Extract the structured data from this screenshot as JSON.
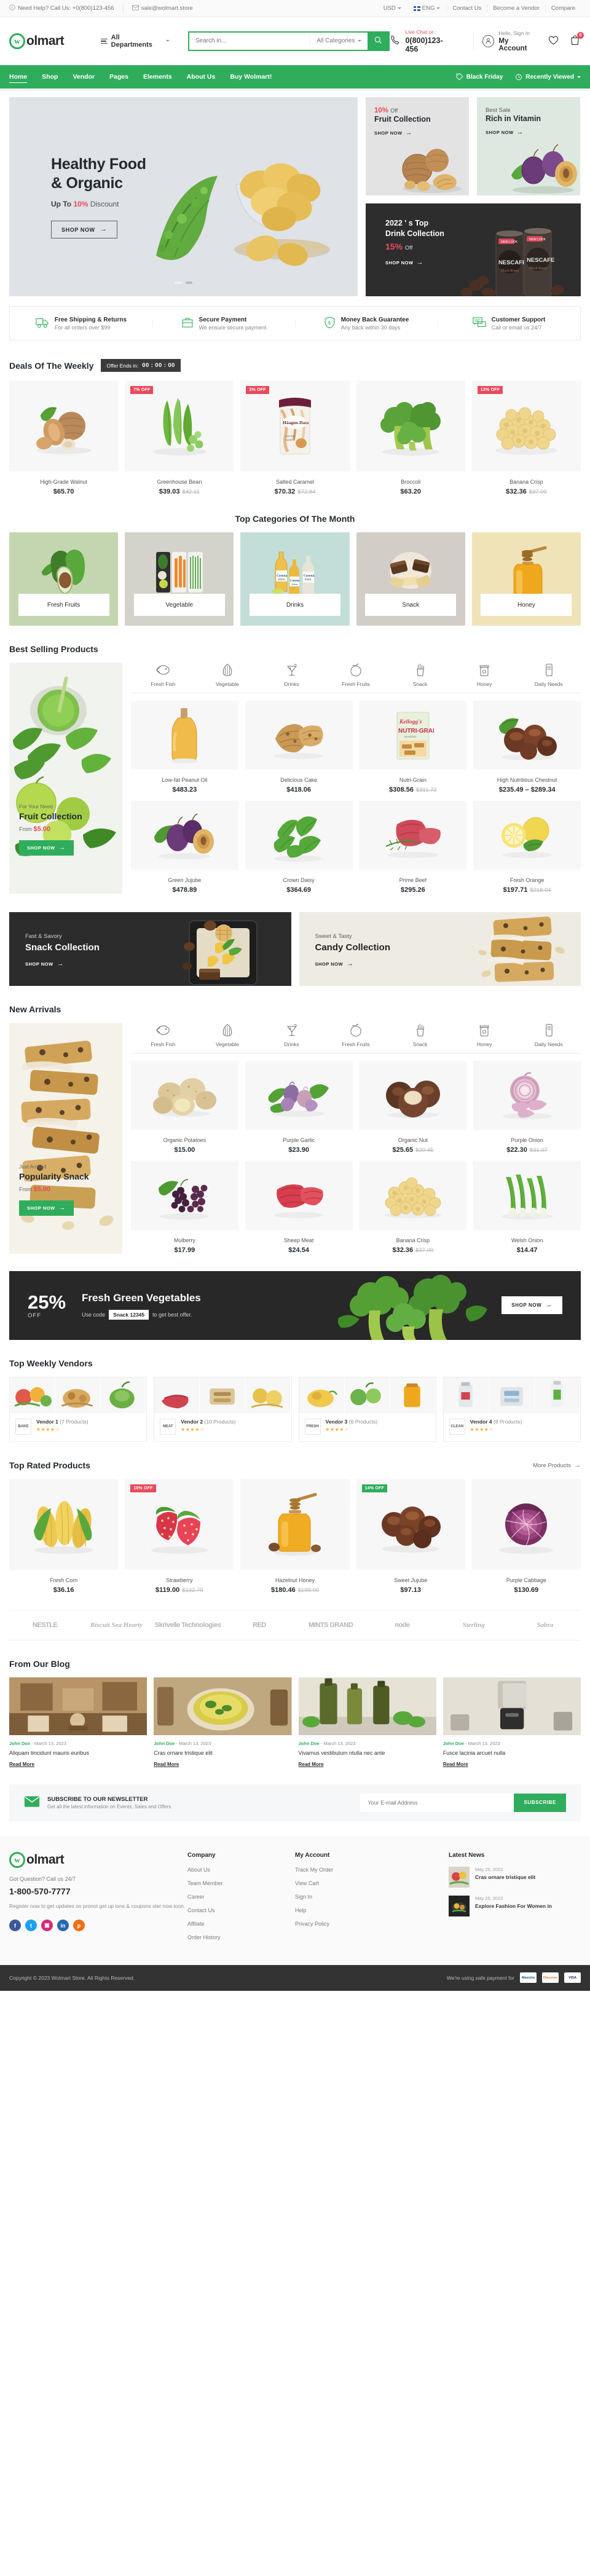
{
  "topbar": {
    "help_text": "Need Help? Call Us: +0(800)123-456",
    "email": "sale@wolmart.store",
    "currency": "USD",
    "language": "ENG",
    "links": [
      "Contact Us",
      "Become a Vendor",
      "Compare"
    ]
  },
  "header": {
    "logo_mark": "w",
    "logo_text": "olmart",
    "departments_label": "All Departments",
    "search_placeholder": "Search in...",
    "search_value": "",
    "category_select": "All Categories",
    "livechat_label": "Live Chat or :",
    "phone": "0(800)123-456",
    "account_greeting": "Hello, Sign In",
    "account_label": "My Account",
    "cart_count": "0",
    "icons": [
      "search-icon",
      "phone-icon",
      "user-icon",
      "heart-icon",
      "cart-icon"
    ]
  },
  "nav": {
    "items": [
      "Home",
      "Shop",
      "Vendor",
      "Pages",
      "Elements",
      "About Us",
      "Buy Wolmart!"
    ],
    "active": "Home",
    "right": [
      "Black Friday",
      "Recently Viewed"
    ]
  },
  "hero": {
    "title_line1": "Healthy Food",
    "title_line2": "& Organic",
    "sub_prefix": "Up To",
    "sub_pct": "10%",
    "sub_suffix": "Discount",
    "cta": "SHOP NOW",
    "dots": 2,
    "active_dot": 0
  },
  "hero_side": {
    "cards": [
      {
        "pct": "10%",
        "off": "Off",
        "title": "Fruit Collection",
        "cta": "SHOP NOW"
      },
      {
        "kicker": "Best Sale",
        "title": "Rich in Vitamin",
        "cta": "SHOP NOW"
      }
    ],
    "wide": {
      "line1": "2022 ' s Top",
      "line2": "Drink Collection",
      "pct": "15%",
      "off": "Off",
      "cta": "SHOP NOW"
    }
  },
  "services": [
    {
      "icon": "truck-icon",
      "title": "Free Shipping & Returns",
      "sub": "For all orders over $99"
    },
    {
      "icon": "briefcase-icon",
      "title": "Secure Payment",
      "sub": "We ensure secure payment"
    },
    {
      "icon": "money-back-icon",
      "title": "Money Back Guarantee",
      "sub": "Any back within 30 days"
    },
    {
      "icon": "chat-support-icon",
      "title": "Customer Support",
      "sub": "Call or email us 24/7"
    }
  ],
  "deals": {
    "title": "Deals Of The Weekly",
    "timer_label": "Offer Ends in:",
    "timer_value": "00 : 00 : 00",
    "products": [
      {
        "name": "High-Grade Walnut",
        "price": "$65.70",
        "old": "",
        "badge": ""
      },
      {
        "name": "Greenhouse Bean",
        "price": "$39.03",
        "old": "$42.11",
        "badge": "7% OFF"
      },
      {
        "name": "Salted Caramel",
        "price": "$70.32",
        "old": "$72.84",
        "badge": "3% OFF"
      },
      {
        "name": "Broccoli",
        "price": "$63.20",
        "old": "",
        "badge": ""
      },
      {
        "name": "Banana Crisp",
        "price": "$32.36",
        "old": "$37.00",
        "badge": "13% OFF"
      }
    ]
  },
  "top_categories": {
    "title": "Top Categories Of The Month",
    "items": [
      {
        "label": "Fresh Fruits"
      },
      {
        "label": "Vegetable"
      },
      {
        "label": "Drinks"
      },
      {
        "label": "Snack"
      },
      {
        "label": "Honey"
      }
    ]
  },
  "best_selling": {
    "title": "Best Selling Products",
    "promo": {
      "p1": "For Your Need",
      "p2": "Fruit Collection",
      "p3_prefix": "From",
      "p3_price": "$5.00",
      "cta": "SHOP NOW"
    },
    "tabs": [
      {
        "label": "Fresh Fish",
        "icon": "fish-icon",
        "active": false
      },
      {
        "label": "Vegetable",
        "icon": "corn-icon",
        "active": false
      },
      {
        "label": "Drinks",
        "icon": "cocktail-icon",
        "active": false
      },
      {
        "label": "Fresh Fruits",
        "icon": "apple-icon",
        "active": false
      },
      {
        "label": "Snack",
        "icon": "fries-icon",
        "active": false
      },
      {
        "label": "Honey",
        "icon": "honey-jar-icon",
        "active": false
      },
      {
        "label": "Daily Needs",
        "icon": "bottle-icon",
        "active": false
      }
    ],
    "row1": [
      {
        "name": "Low-fat Peanut Oil",
        "price": "$483.23",
        "old": ""
      },
      {
        "name": "Delicious Cake",
        "price": "$418.06",
        "old": ""
      },
      {
        "name": "Nutri-Grain",
        "price": "$308.56",
        "old": "$311.73"
      },
      {
        "name": "High Nutritious Chestnut",
        "price": "$235.49 – $289.34",
        "old": ""
      }
    ],
    "row2": [
      {
        "name": "Green Jujube",
        "price": "$478.89",
        "old": ""
      },
      {
        "name": "Crown Daisy",
        "price": "$364.69",
        "old": ""
      },
      {
        "name": "Prime Beef",
        "price": "$295.26",
        "old": ""
      },
      {
        "name": "Fresh Orange",
        "price": "$197.71",
        "old": "$218.04"
      }
    ]
  },
  "mid_banners": [
    {
      "kicker": "Fast & Savory",
      "title": "Snack Collection",
      "cta": "SHOP NOW",
      "theme": "dark"
    },
    {
      "kicker": "Sweet & Tasty",
      "title": "Candy Collection",
      "cta": "SHOP NOW",
      "theme": "light"
    }
  ],
  "new_arrivals": {
    "title": "New Arrivals",
    "promo": {
      "p1": "Just Arrived",
      "p2": "Popularity Snack",
      "p3_prefix": "From",
      "p3_price": "$5.00",
      "cta": "SHOP NOW"
    },
    "tabs": [
      {
        "label": "Fresh Fish",
        "icon": "fish-icon",
        "active": false
      },
      {
        "label": "Vegetable",
        "icon": "corn-icon",
        "active": false
      },
      {
        "label": "Drinks",
        "icon": "cocktail-icon",
        "active": false
      },
      {
        "label": "Fresh Fruits",
        "icon": "apple-icon",
        "active": false
      },
      {
        "label": "Snack",
        "icon": "fries-icon",
        "active": false
      },
      {
        "label": "Honey",
        "icon": "honey-jar-icon",
        "active": false
      },
      {
        "label": "Daily Needs",
        "icon": "bottle-icon",
        "active": false
      }
    ],
    "row1": [
      {
        "name": "Organic Potatoes",
        "price": "$15.00",
        "old": ""
      },
      {
        "name": "Purple Garlic",
        "price": "$23.90",
        "old": ""
      },
      {
        "name": "Organic Nut",
        "price": "$25.65",
        "old": "$30.45"
      },
      {
        "name": "Purple Onion",
        "price": "$22.30",
        "old": "$31.07"
      }
    ],
    "row2": [
      {
        "name": "Mulberry",
        "price": "$17.99",
        "old": ""
      },
      {
        "name": "Sheep Meat",
        "price": "$24.54",
        "old": ""
      },
      {
        "name": "Banana Crisp",
        "price": "$32.36",
        "old": "$37.00"
      },
      {
        "name": "Welsh Onion",
        "price": "$14.47",
        "old": ""
      }
    ]
  },
  "big_banner": {
    "pct": "25%",
    "off": "OFF",
    "heading": "Fresh Green Vegetables",
    "use_code_label": "Use code",
    "code": "Snack 12345",
    "tail": "to get best offer.",
    "cta": "SHOP NOW"
  },
  "vendors": {
    "title": "Top Weekly Vendors",
    "items": [
      {
        "logo": "BAKE",
        "name": "Vendor 1",
        "count": "(7 Products)",
        "rating": 4
      },
      {
        "logo": "MEAT",
        "name": "Vendor 2",
        "count": "(10 Products)",
        "rating": 4
      },
      {
        "logo": "FRESH",
        "name": "Vendor 3",
        "count": "(6 Products)",
        "rating": 4
      },
      {
        "logo": "CLEAN",
        "name": "Vendor 4",
        "count": "(8 Products)",
        "rating": 4
      }
    ]
  },
  "top_rated": {
    "title": "Top Rated Products",
    "more": "More Products",
    "products": [
      {
        "name": "Fresh Corn",
        "price": "$36.16",
        "old": "",
        "badge": ""
      },
      {
        "name": "Strawberry",
        "price": "$119.00",
        "old": "$132.79",
        "badge": "10% OFF"
      },
      {
        "name": "Hazelnut Honey",
        "price": "$180.46",
        "old": "$199.00",
        "badge": ""
      },
      {
        "name": "Sweet Jujube",
        "price": "$97.13",
        "old": "",
        "badge": "14% OFF"
      },
      {
        "name": "Purple Cabbage",
        "price": "$130.69",
        "old": "",
        "badge": ""
      }
    ]
  },
  "brands": [
    "NESTLE",
    "Biscuit Sea Hearty",
    "Skrivelle Technologies",
    "RED",
    "MINTS GRAND",
    "node",
    "Sterling",
    "Sabra"
  ],
  "blog": {
    "title": "From Our Blog",
    "posts": [
      {
        "author": "John Doe",
        "date": "March 13, 2023",
        "title": "Aliquam tincidunt mauris euribus",
        "more": "Read More"
      },
      {
        "author": "John Doe",
        "date": "March 13, 2023",
        "title": "Cras ornare tristique elit",
        "more": "Read More"
      },
      {
        "author": "John Doe",
        "date": "March 13, 2023",
        "title": "Vivamus vestibulum ntulla nec ante",
        "more": "Read More"
      },
      {
        "author": "John Doe",
        "date": "March 13, 2023",
        "title": "Fusce lacinia arcuet nulla",
        "more": "Read More"
      }
    ]
  },
  "newsletter": {
    "icon": "envelope-icon",
    "title": "SUBSCRIBE TO OUR NEWSLETTER",
    "sub": "Get all the latest information on Events, Sales and Offers.",
    "placeholder": "Your E-mail Address",
    "value": "",
    "button": "SUBSCRIBE"
  },
  "footer": {
    "logo_mark": "w",
    "logo_text": "olmart",
    "question": "Got Question? Call us 24/7",
    "phone": "1-800-570-7777",
    "desc": "Register now to get updates on pronot get up ions & coupons ster now toon.",
    "socials": [
      "facebook-icon",
      "twitter-icon",
      "instagram-icon",
      "linkedin-icon",
      "pinterest-icon"
    ],
    "company": {
      "heading": "Company",
      "links": [
        "About Us",
        "Team Member",
        "Career",
        "Contact Us",
        "Affilate",
        "Order History"
      ]
    },
    "account": {
      "heading": "My Account",
      "links": [
        "Track My Order",
        "View Cart",
        "Sign In",
        "Help",
        "Privacy Policy"
      ]
    },
    "latest_news": {
      "heading": "Latest News",
      "posts": [
        {
          "date": "May 25, 2022",
          "title": "Cras ornare tristique elit"
        },
        {
          "date": "May 25, 2022",
          "title": "Explore Fashion For Women in"
        }
      ]
    },
    "copyright": "Copyright © 2023 Wolmart Store. All Rights Reserved.",
    "payment_text": "We're using safe payment for",
    "payment_methods": [
      "Maestro",
      "Discover",
      "VISA"
    ]
  },
  "colors": {
    "brand_green": "#2fad5c",
    "accent_red": "#e94b5a",
    "dark": "#282828"
  }
}
